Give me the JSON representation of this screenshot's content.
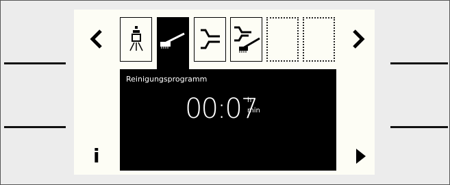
{
  "nav": {
    "prev_icon": "chevron-left-icon",
    "next_icon": "chevron-right-icon",
    "prev_glyph": "<",
    "next_glyph": ">"
  },
  "tabs": [
    {
      "name": "tab-rinse-program",
      "icon": "shower-icon",
      "state": "inactive"
    },
    {
      "name": "tab-cleaning-program",
      "icon": "brush-icon",
      "state": "active"
    },
    {
      "name": "tab-pipe-program",
      "icon": "pipe-icon",
      "state": "inactive"
    },
    {
      "name": "tab-pipe-cleaning-program",
      "icon": "pipe-brush-icon",
      "state": "inactive"
    },
    {
      "name": "tab-empty-1",
      "icon": "",
      "state": "empty"
    },
    {
      "name": "tab-empty-2",
      "icon": "",
      "state": "empty"
    }
  ],
  "panel": {
    "program_label": "Reinigungsprogramm",
    "time_value": "00:07",
    "unit_hours": "h",
    "unit_minutes": "min"
  },
  "footer": {
    "info_glyph": "i",
    "info_icon": "info-icon",
    "play_icon": "play-icon"
  },
  "colors": {
    "screen_bg": "#fdfdf5",
    "panel_bg": "#000000",
    "frame_bg": "#ececec"
  }
}
